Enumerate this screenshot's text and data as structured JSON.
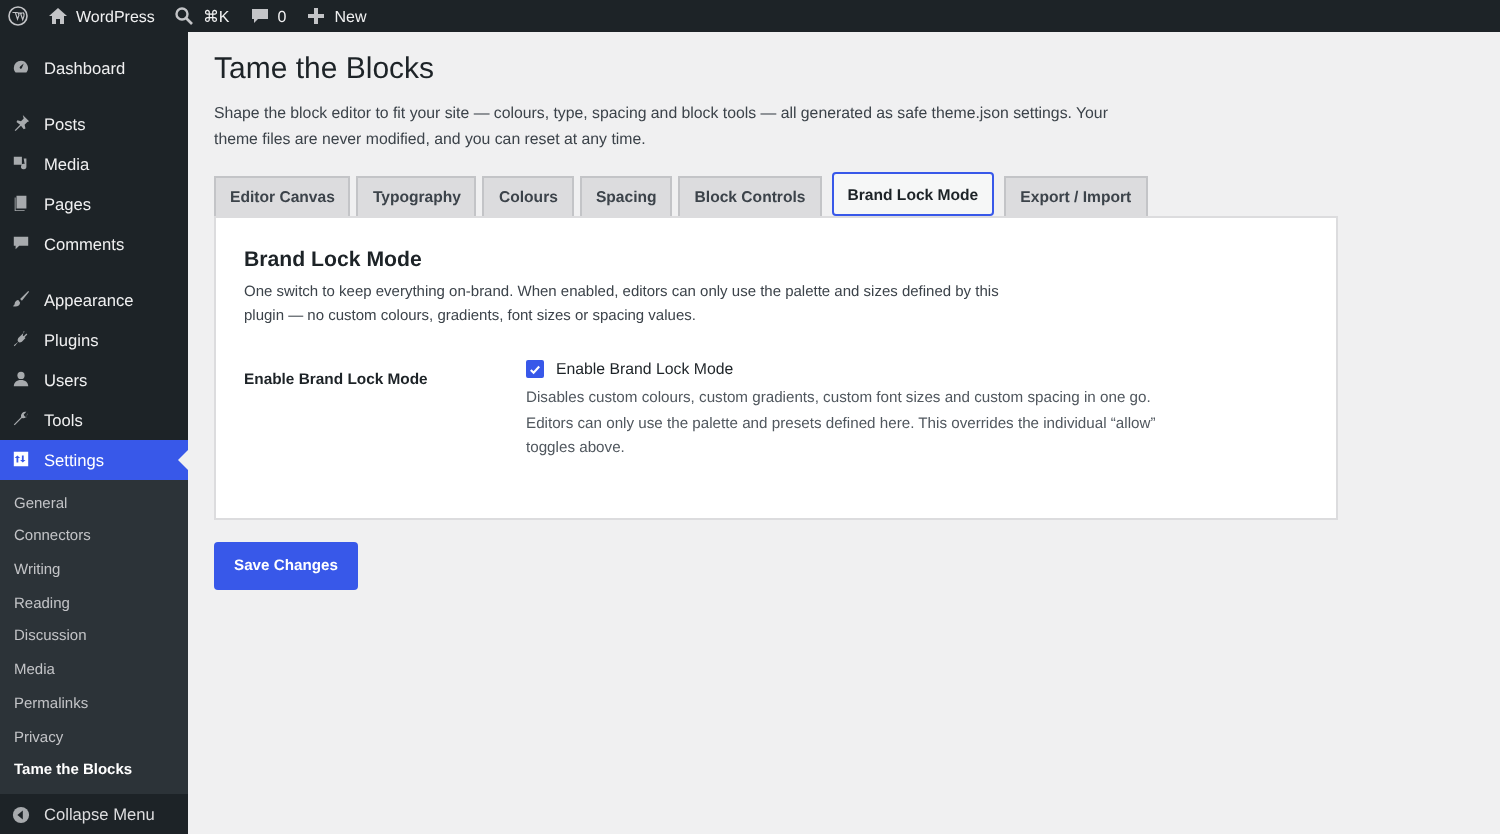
{
  "admin_bar": {
    "items": [
      {
        "kind": "logo"
      },
      {
        "kind": "home",
        "label": "WordPress"
      },
      {
        "kind": "search",
        "label": "⌘K"
      },
      {
        "kind": "comments",
        "label": "0"
      },
      {
        "kind": "new",
        "label": "New"
      }
    ]
  },
  "sidebar": {
    "items": [
      {
        "label": "Dashboard",
        "selected": false,
        "group_start": false
      },
      {
        "label": "Posts",
        "selected": false,
        "group_start": true
      },
      {
        "label": "Media",
        "selected": false,
        "group_start": false
      },
      {
        "label": "Pages",
        "selected": false,
        "group_start": false
      },
      {
        "label": "Comments",
        "selected": false,
        "group_start": false
      },
      {
        "label": "Appearance",
        "selected": false,
        "group_start": true
      },
      {
        "label": "Plugins",
        "selected": false,
        "group_start": false
      },
      {
        "label": "Users",
        "selected": false,
        "group_start": false
      },
      {
        "label": "Tools",
        "selected": false,
        "group_start": false
      },
      {
        "label": "Settings",
        "selected": true,
        "group_start": false,
        "children": [
          {
            "label": "General",
            "selected": false
          },
          {
            "label": "Connectors",
            "selected": false
          },
          {
            "label": "Writing",
            "selected": false
          },
          {
            "label": "Reading",
            "selected": false
          },
          {
            "label": "Discussion",
            "selected": false
          },
          {
            "label": "Media",
            "selected": false
          },
          {
            "label": "Permalinks",
            "selected": false
          },
          {
            "label": "Privacy",
            "selected": false
          },
          {
            "label": "Tame the Blocks",
            "selected": true
          }
        ]
      }
    ],
    "collapse": "Collapse Menu"
  },
  "page": {
    "title": "Tame the Blocks",
    "description": "Shape the block editor to fit your site — colours, type, spacing and block tools — all generated as safe theme.json settings. Your theme files are never modified, and you can reset at any time."
  },
  "tabs": [
    {
      "label": "Editor Canvas",
      "selected": false
    },
    {
      "label": "Typography",
      "selected": false
    },
    {
      "label": "Colours",
      "selected": false
    },
    {
      "label": "Spacing",
      "selected": false
    },
    {
      "label": "Block Controls",
      "selected": false
    },
    {
      "label": "Brand Lock Mode",
      "selected": true
    },
    {
      "label": "Export / Import",
      "selected": false
    }
  ],
  "panel": {
    "heading": "Brand Lock Mode",
    "description": "One switch to keep everything on-brand. When enabled, editors can only use the palette and sizes defined by this plugin — no custom colours, gradients, font sizes or spacing values.",
    "fields": [
      {
        "label": "Enable Brand Lock Mode",
        "checkbox_label": "Enable Brand Lock Mode",
        "checked": true,
        "help": "Disables custom colours, custom gradients, custom font sizes and custom spacing in one go. Editors can only use the palette and presets defined here. This overrides the individual “allow” toggles above."
      }
    ]
  },
  "save_button": "Save Changes"
}
